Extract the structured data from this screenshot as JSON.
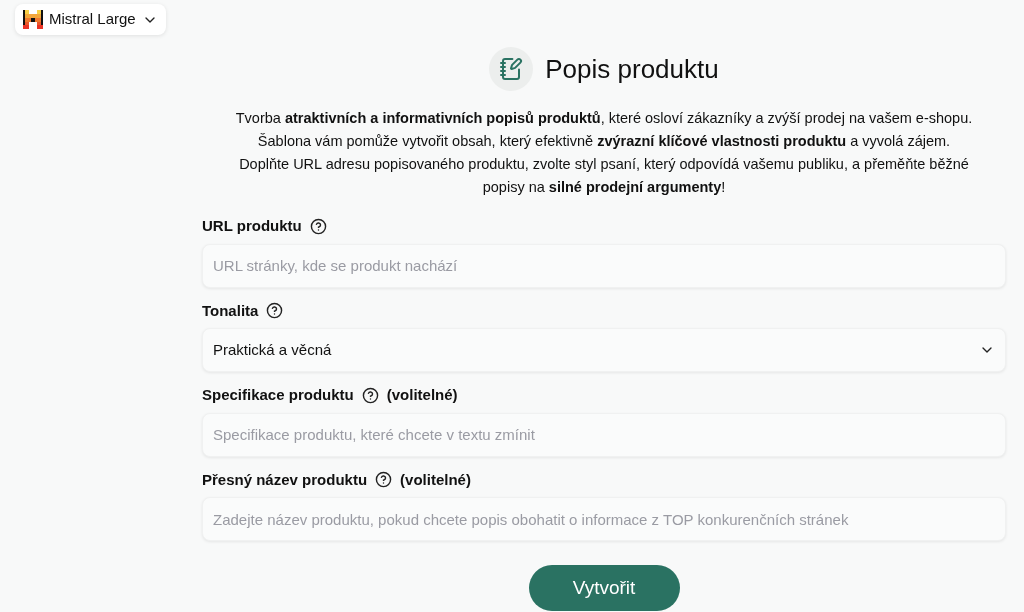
{
  "model_selector": {
    "label": "Mistral Large"
  },
  "title": "Popis produktu",
  "description_lines": [
    "Tvorba **atraktivních a informativních popisů produktů**, které osloví zákazníky a zvýší prodej na vašem e-shopu.",
    "Šablona vám pomůže vytvořit obsah, který efektivně **zvýrazní klíčové vlastnosti produktu** a vyvolá zájem.",
    "Doplňte URL adresu popisovaného produktu, zvolte styl psaní, který odpovídá vašemu publiku, a přeměňte běžné",
    "popisy na **silné prodejní argumenty**!"
  ],
  "fields": [
    {
      "kind": "text",
      "label": "URL produktu",
      "placeholder": "URL stránky, kde se produkt nachází"
    },
    {
      "kind": "select",
      "label": "Tonalita",
      "value": "Praktická a věcná"
    },
    {
      "kind": "text",
      "label": "Specifikace produktu",
      "optional_note": "(volitelné)",
      "placeholder": "Specifikace produktu, které chcete v textu zmínit"
    },
    {
      "kind": "text",
      "label": "Přesný název produktu",
      "optional_note": "(volitelné)",
      "placeholder": "Zadejte název produktu, pokud chcete popis obohatit o informace z TOP konkurenčních stránek"
    }
  ],
  "submit_button": "Vytvořit"
}
